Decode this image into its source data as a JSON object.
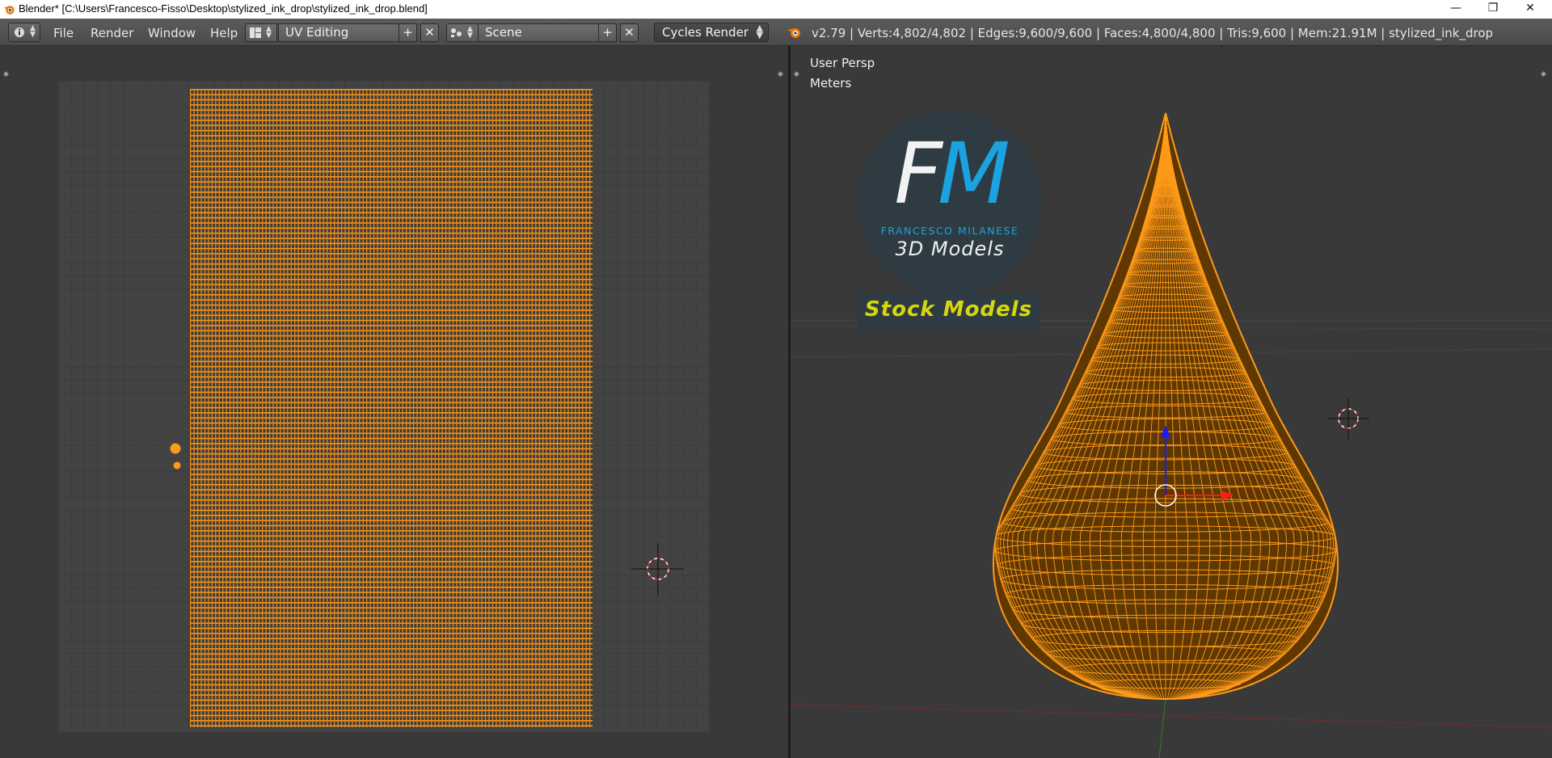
{
  "window": {
    "title": "Blender* [C:\\Users\\Francesco-Fisso\\Desktop\\stylized_ink_drop\\stylized_ink_drop.blend]",
    "minimize": "—",
    "maximize": "❐",
    "close": "✕"
  },
  "header": {
    "menus": [
      "File",
      "Render",
      "Window",
      "Help"
    ],
    "screen_layout": "UV Editing",
    "scene": "Scene",
    "add_symbol": "+",
    "remove_symbol": "✕",
    "render_engine": "Cycles Render",
    "stats": "v2.79 | Verts:4,802/4,802 | Edges:9,600/9,600 | Faces:4,800/4,800 | Tris:9,600 | Mem:21.91M | stylized_ink_drop"
  },
  "viewport": {
    "view_label": "User Persp",
    "units_label": "Meters"
  },
  "watermark": {
    "f_letter": "F",
    "m_letter": "M",
    "name": "FRANCESCO MILANESE",
    "subtitle": "3D Models",
    "badge": "Stock Models"
  },
  "colors": {
    "accent_orange": "#ff9a1a",
    "viewport_bg": "#393939",
    "logo_blue": "#1aa3e0",
    "logo_yellow": "#d6d60c"
  },
  "icons": [
    "blender-icon",
    "info-editor-icon",
    "screen-layout-icon",
    "scene-icon",
    "render-engine-icon",
    "cursor-3d-icon"
  ]
}
